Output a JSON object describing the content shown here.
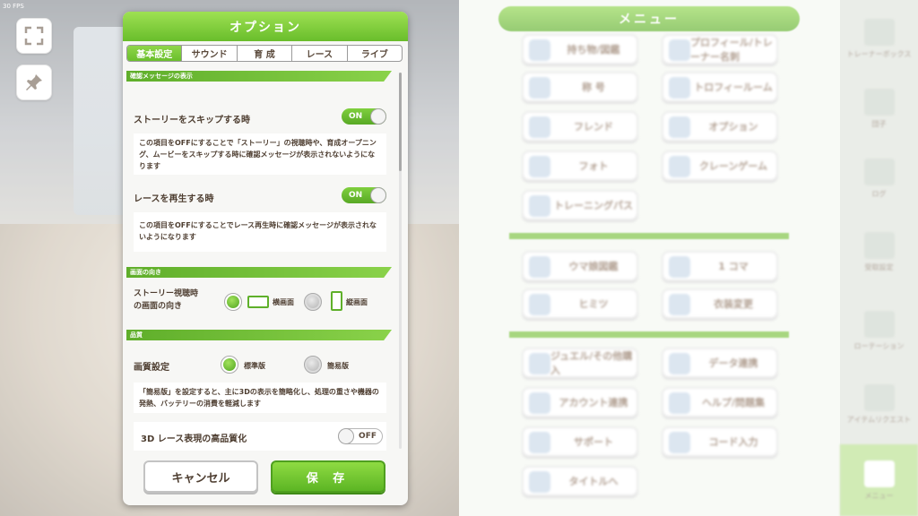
{
  "fps": "30 FPS",
  "dialog": {
    "title": "オプション",
    "tabs": [
      "基本設定",
      "サウンド",
      "育 成",
      "レース",
      "ライブ"
    ],
    "sections": {
      "confirm": "確認メッセージの表示",
      "orientation": "画面の向き",
      "quality": "品質"
    },
    "story_skip": {
      "label": "ストーリーをスキップする時",
      "state": "ON",
      "desc": "この項目をOFFにすることで「ストーリー」の視聴時や、育成オープニング、ムービーをスキップする時に確認メッセージが表示されないようになります"
    },
    "race_play": {
      "label": "レースを再生する時",
      "state": "ON",
      "desc": "この項目をOFFにすることでレース再生時に確認メッセージが表示されないようになります"
    },
    "orientation": {
      "label_line1": "ストーリー視聴時",
      "label_line2": "の画面の向き",
      "opt1": "横画面",
      "opt2": "縦画面"
    },
    "quality": {
      "label": "画質設定",
      "opt1": "標準版",
      "opt2": "簡易版",
      "desc": "「簡易版」を設定すると、主に3Dの表示を簡略化し、処理の重さや機器の発熱、バッテリーの消費を軽減します"
    },
    "race_hq": {
      "label": "3D レース表現の高品質化",
      "state": "OFF"
    },
    "cancel_label": "キャンセル",
    "save_label": "保 存"
  },
  "menu": {
    "title": "メニュー",
    "items": [
      "持ち物/図鑑",
      "プロフィール/トレーナー名刺",
      "称 号",
      "トロフィールーム",
      "フレンド",
      "オプション",
      "フォト",
      "クレーンゲーム",
      "トレーニングパス",
      "ウマ娘図鑑",
      "1 コマ",
      "ヒミツ",
      "衣装変更",
      "ジュエル/その他購入",
      "データ連携",
      "アカウント連携",
      "ヘルプ/問題集",
      "サポート",
      "コード入力",
      "タイトルへ"
    ],
    "side_tabs": [
      "トレーナーボックス",
      "団子",
      "ログ",
      "受取設定",
      "ローテーション",
      "アイテムリクエスト",
      "メニュー"
    ]
  }
}
